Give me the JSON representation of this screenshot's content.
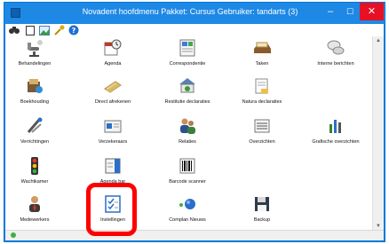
{
  "window": {
    "title": "Novadent hoofdmenu  Pakket: Cursus  Gebruiker: tandarts (3)",
    "min_label": "–",
    "max_label": "☐",
    "close_label": "✕"
  },
  "toolbar": {
    "icons": [
      "binoculars-icon",
      "blank-page-icon",
      "picture-icon",
      "key-icon",
      "help-icon"
    ]
  },
  "menu": {
    "row1": [
      "Behandelingen",
      "Agenda",
      "Correspondentie",
      "Taken",
      "Interne berichten"
    ],
    "row2": [
      "Boekhouding",
      "Direct afrekenen",
      "Restitutie declaraties",
      "Natura declaraties"
    ],
    "row3": [
      "Verrichtingen",
      "Verzekeraars",
      "Relaties",
      "Overzichten",
      "Grafische overzichten"
    ],
    "row4": [
      "Wachtkamer",
      "Agenda bar",
      "Barcode scanner"
    ],
    "row5": [
      "Medewerkers",
      "Instellingen",
      "Complan Nieuws",
      "Backup"
    ]
  },
  "colors": {
    "titlebar": "#1e88e5",
    "close": "#e81123",
    "highlight": "#ff0000"
  }
}
